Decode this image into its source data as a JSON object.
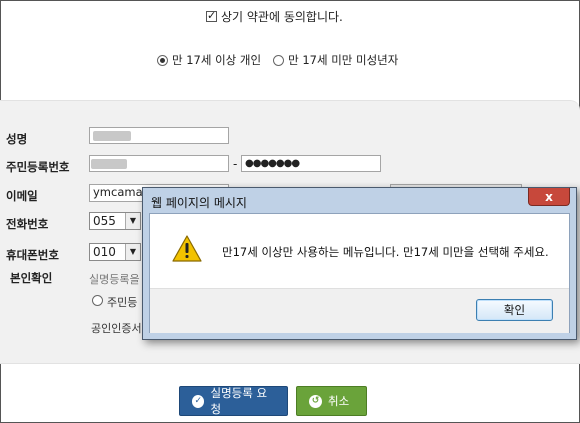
{
  "agree": {
    "checked": true,
    "label": "상기 약관에 동의합니다."
  },
  "user_type": {
    "options": [
      {
        "label": "만 17세 이상 개인",
        "selected": true
      },
      {
        "label": "만 17세 미만 미성년자",
        "selected": false
      }
    ]
  },
  "form": {
    "name_label": "성명",
    "rrn_label": "주민등록번호",
    "rrn_separator": "-",
    "rrn_back_value": "●●●●●●●",
    "email_label": "이메일",
    "email_value": "ymcamar",
    "phone_label": "전화번호",
    "phone_area": "055",
    "mobile_label": "휴대폰번호",
    "mobile_prefix": "010",
    "verify_label": "본인확인",
    "verify_text": "실명등록을 무",
    "verify_option": "주민등",
    "cert_text": "공인인증서"
  },
  "buttons": {
    "submit_label": "실명등록 요청",
    "cancel_label": "취소"
  },
  "dialog": {
    "title": "웹 페이지의 메시지",
    "close_label": "x",
    "message": "만17세 이상만 사용하는 메뉴입니다. 만17세 미만을 선택해 주세요.",
    "ok_label": "확인"
  },
  "colors": {
    "submit_button": "#2c5f99",
    "cancel_button": "#6aa33a",
    "dialog_frame": "#bfd1e6",
    "close_button": "#c7483b",
    "warning_icon": "#f2c200"
  }
}
